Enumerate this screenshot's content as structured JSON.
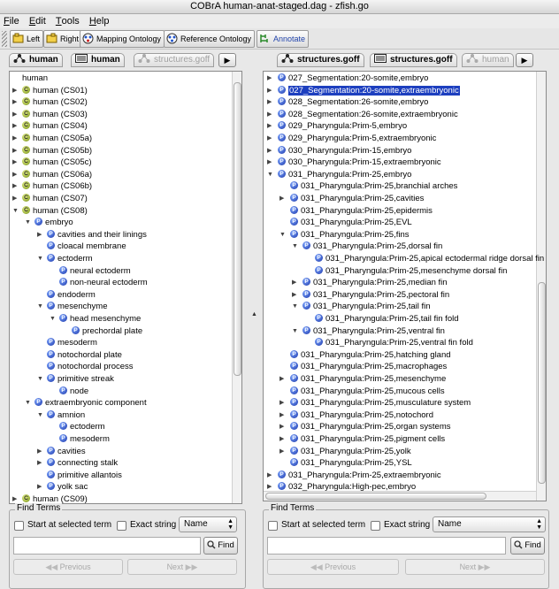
{
  "window": {
    "title": "COBrA  human-anat-staged.dag - zfish.go"
  },
  "menu": [
    {
      "label": "File",
      "underline": "F",
      "rest": "ile"
    },
    {
      "label": "Edit",
      "underline": "E",
      "rest": "dit"
    },
    {
      "label": "Tools",
      "underline": "T",
      "rest": "ools"
    },
    {
      "label": "Help",
      "underline": "H",
      "rest": "elp"
    }
  ],
  "toolbar": {
    "left": "Left",
    "right": "Right",
    "mapping": "Mapping Ontology",
    "reference": "Reference Ontology",
    "annotate": "Annotate"
  },
  "left_pane": {
    "tabs": [
      "human",
      "human",
      "structures.goff"
    ],
    "tree": [
      {
        "label": "human",
        "level": 0,
        "toggle": "",
        "icon": ""
      },
      {
        "label": "human (CS01)",
        "level": 0,
        "toggle": "right",
        "icon": "C"
      },
      {
        "label": "human (CS02)",
        "level": 0,
        "toggle": "right",
        "icon": "C"
      },
      {
        "label": "human (CS03)",
        "level": 0,
        "toggle": "right",
        "icon": "C"
      },
      {
        "label": "human (CS04)",
        "level": 0,
        "toggle": "right",
        "icon": "C"
      },
      {
        "label": "human (CS05a)",
        "level": 0,
        "toggle": "right",
        "icon": "C"
      },
      {
        "label": "human (CS05b)",
        "level": 0,
        "toggle": "right",
        "icon": "C"
      },
      {
        "label": "human (CS05c)",
        "level": 0,
        "toggle": "right",
        "icon": "C"
      },
      {
        "label": "human (CS06a)",
        "level": 0,
        "toggle": "right",
        "icon": "C"
      },
      {
        "label": "human (CS06b)",
        "level": 0,
        "toggle": "right",
        "icon": "C"
      },
      {
        "label": "human (CS07)",
        "level": 0,
        "toggle": "right",
        "icon": "C"
      },
      {
        "label": "human (CS08)",
        "level": 0,
        "toggle": "down",
        "icon": "C"
      },
      {
        "label": "embryo",
        "level": 1,
        "toggle": "down",
        "icon": "P"
      },
      {
        "label": "cavities and their linings",
        "level": 2,
        "toggle": "right",
        "icon": "P"
      },
      {
        "label": "cloacal membrane",
        "level": 2,
        "toggle": "",
        "icon": "P"
      },
      {
        "label": "ectoderm",
        "level": 2,
        "toggle": "down",
        "icon": "P"
      },
      {
        "label": "neural ectoderm",
        "level": 3,
        "toggle": "",
        "icon": "P"
      },
      {
        "label": "non-neural ectoderm",
        "level": 3,
        "toggle": "",
        "icon": "P"
      },
      {
        "label": "endoderm",
        "level": 2,
        "toggle": "",
        "icon": "P"
      },
      {
        "label": "mesenchyme",
        "level": 2,
        "toggle": "down",
        "icon": "P"
      },
      {
        "label": "head mesenchyme",
        "level": 3,
        "toggle": "down",
        "icon": "P"
      },
      {
        "label": "prechordal plate",
        "level": 4,
        "toggle": "",
        "icon": "P"
      },
      {
        "label": "mesoderm",
        "level": 2,
        "toggle": "",
        "icon": "P"
      },
      {
        "label": "notochordal plate",
        "level": 2,
        "toggle": "",
        "icon": "P"
      },
      {
        "label": "notochordal process",
        "level": 2,
        "toggle": "",
        "icon": "P"
      },
      {
        "label": "primitive streak",
        "level": 2,
        "toggle": "down",
        "icon": "P"
      },
      {
        "label": "node",
        "level": 3,
        "toggle": "",
        "icon": "P"
      },
      {
        "label": "extraembryonic component",
        "level": 1,
        "toggle": "down",
        "icon": "P"
      },
      {
        "label": "amnion",
        "level": 2,
        "toggle": "down",
        "icon": "P"
      },
      {
        "label": "ectoderm",
        "level": 3,
        "toggle": "",
        "icon": "P"
      },
      {
        "label": "mesoderm",
        "level": 3,
        "toggle": "",
        "icon": "P"
      },
      {
        "label": "cavities",
        "level": 2,
        "toggle": "right",
        "icon": "P"
      },
      {
        "label": "connecting stalk",
        "level": 2,
        "toggle": "right",
        "icon": "P"
      },
      {
        "label": "primitive allantois",
        "level": 2,
        "toggle": "",
        "icon": "P"
      },
      {
        "label": "yolk sac",
        "level": 2,
        "toggle": "right",
        "icon": "P"
      },
      {
        "label": "human (CS09)",
        "level": 0,
        "toggle": "right",
        "icon": "C"
      }
    ],
    "find": {
      "legend": "Find Terms",
      "start_label": "Start at selected term",
      "exact_label": "Exact string",
      "select_value": "Name",
      "input_value": "",
      "find_button": "Find",
      "previous": "Previous",
      "next": "Next"
    }
  },
  "right_pane": {
    "tabs": [
      "structures.goff",
      "structures.goff",
      "human"
    ],
    "tree": [
      {
        "label": "027_Segmentation:20-somite,embryo",
        "level": 0,
        "toggle": "right",
        "icon": "P"
      },
      {
        "label": "027_Segmentation:20-somite,extraembryonic",
        "level": 0,
        "toggle": "right",
        "icon": "P",
        "selected": true
      },
      {
        "label": "028_Segmentation:26-somite,embryo",
        "level": 0,
        "toggle": "right",
        "icon": "P"
      },
      {
        "label": "028_Segmentation:26-somite,extraembryonic",
        "level": 0,
        "toggle": "right",
        "icon": "P"
      },
      {
        "label": "029_Pharyngula:Prim-5,embryo",
        "level": 0,
        "toggle": "right",
        "icon": "P"
      },
      {
        "label": "029_Pharyngula:Prim-5,extraembryonic",
        "level": 0,
        "toggle": "right",
        "icon": "P"
      },
      {
        "label": "030_Pharyngula:Prim-15,embryo",
        "level": 0,
        "toggle": "right",
        "icon": "P"
      },
      {
        "label": "030_Pharyngula:Prim-15,extraembryonic",
        "level": 0,
        "toggle": "right",
        "icon": "P"
      },
      {
        "label": "031_Pharyngula:Prim-25,embryo",
        "level": 0,
        "toggle": "down",
        "icon": "P"
      },
      {
        "label": "031_Pharyngula:Prim-25,branchial arches",
        "level": 1,
        "toggle": "",
        "icon": "P"
      },
      {
        "label": "031_Pharyngula:Prim-25,cavities",
        "level": 1,
        "toggle": "right",
        "icon": "P"
      },
      {
        "label": "031_Pharyngula:Prim-25,epidermis",
        "level": 1,
        "toggle": "",
        "icon": "P"
      },
      {
        "label": "031_Pharyngula:Prim-25,EVL",
        "level": 1,
        "toggle": "",
        "icon": "P"
      },
      {
        "label": "031_Pharyngula:Prim-25,fins",
        "level": 1,
        "toggle": "down",
        "icon": "P"
      },
      {
        "label": "031_Pharyngula:Prim-25,dorsal fin",
        "level": 2,
        "toggle": "down",
        "icon": "P"
      },
      {
        "label": "031_Pharyngula:Prim-25,apical ectodermal ridge dorsal fin",
        "level": 3,
        "toggle": "",
        "icon": "P"
      },
      {
        "label": "031_Pharyngula:Prim-25,mesenchyme dorsal fin",
        "level": 3,
        "toggle": "",
        "icon": "P"
      },
      {
        "label": "031_Pharyngula:Prim-25,median fin",
        "level": 2,
        "toggle": "right",
        "icon": "P"
      },
      {
        "label": "031_Pharyngula:Prim-25,pectoral fin",
        "level": 2,
        "toggle": "right",
        "icon": "P"
      },
      {
        "label": "031_Pharyngula:Prim-25,tail fin",
        "level": 2,
        "toggle": "down",
        "icon": "P"
      },
      {
        "label": "031_Pharyngula:Prim-25,tail fin fold",
        "level": 3,
        "toggle": "",
        "icon": "P"
      },
      {
        "label": "031_Pharyngula:Prim-25,ventral fin",
        "level": 2,
        "toggle": "down",
        "icon": "P"
      },
      {
        "label": "031_Pharyngula:Prim-25,ventral fin fold",
        "level": 3,
        "toggle": "",
        "icon": "P"
      },
      {
        "label": "031_Pharyngula:Prim-25,hatching gland",
        "level": 1,
        "toggle": "",
        "icon": "P"
      },
      {
        "label": "031_Pharyngula:Prim-25,macrophages",
        "level": 1,
        "toggle": "",
        "icon": "P"
      },
      {
        "label": "031_Pharyngula:Prim-25,mesenchyme",
        "level": 1,
        "toggle": "right",
        "icon": "P"
      },
      {
        "label": "031_Pharyngula:Prim-25,mucous cells",
        "level": 1,
        "toggle": "",
        "icon": "P"
      },
      {
        "label": "031_Pharyngula:Prim-25,musculature system",
        "level": 1,
        "toggle": "right",
        "icon": "P"
      },
      {
        "label": "031_Pharyngula:Prim-25,notochord",
        "level": 1,
        "toggle": "right",
        "icon": "P"
      },
      {
        "label": "031_Pharyngula:Prim-25,organ systems",
        "level": 1,
        "toggle": "right",
        "icon": "P"
      },
      {
        "label": "031_Pharyngula:Prim-25,pigment cells",
        "level": 1,
        "toggle": "right",
        "icon": "P"
      },
      {
        "label": "031_Pharyngula:Prim-25,yolk",
        "level": 1,
        "toggle": "right",
        "icon": "P"
      },
      {
        "label": "031_Pharyngula:Prim-25,YSL",
        "level": 1,
        "toggle": "",
        "icon": "P"
      },
      {
        "label": "031_Pharyngula:Prim-25,extraembryonic",
        "level": 0,
        "toggle": "right",
        "icon": "P"
      },
      {
        "label": "032_Pharyngula:High-pec,embryo",
        "level": 0,
        "toggle": "right",
        "icon": "P"
      }
    ],
    "find": {
      "legend": "Find Terms",
      "start_label": "Start at selected term",
      "exact_label": "Exact string",
      "select_value": "Name",
      "input_value": "",
      "find_button": "Find",
      "previous": "Previous",
      "next": "Next"
    }
  },
  "colors": {
    "selection": "#1d3fbf",
    "part_icon": "#1833a8",
    "class_icon": "#6f8a10"
  }
}
